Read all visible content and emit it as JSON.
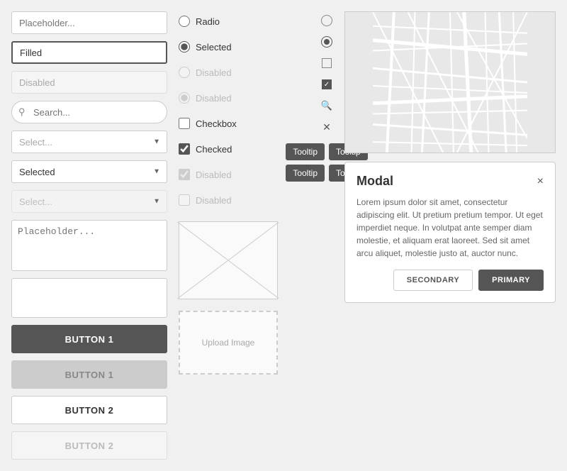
{
  "left": {
    "placeholder_label": "Placeholder...",
    "filled_label": "Filled",
    "disabled_label": "Disabled",
    "search_placeholder": "Search...",
    "select_placeholder": "Select...",
    "selected_value": "Selected",
    "select_disabled": "Select...",
    "textarea_placeholder": "Placeholder...",
    "btn1_primary": "BUTTON 1",
    "btn1_disabled": "BUTTON 1",
    "btn2_outline": "BUTTON 2",
    "btn2_disabled": "BUTTON 2"
  },
  "middle": {
    "radio_label": "Radio",
    "selected_label": "Selected",
    "disabled_radio1": "Disabled",
    "disabled_radio2": "Disabled",
    "checkbox_label": "Checkbox",
    "checked_label": "Checked",
    "disabled_check1": "Disabled",
    "disabled_check2": "Disabled",
    "tooltip1": "Tooltip",
    "tooltip2": "Tooltip",
    "tooltip3": "Tooltip",
    "tooltip4": "Tooltip",
    "upload_label": "Upload Image"
  },
  "modal": {
    "title": "Modal",
    "body": "Lorem ipsum dolor sit amet, consectetur adipiscing elit. Ut pretium pretium tempor. Ut eget imperdiet neque. In volutpat ante semper diam molestie, et aliquam erat laoreet. Sed sit amet arcu aliquet, molestie justo at, auctor nunc.",
    "secondary_btn": "SECONDARY",
    "primary_btn": "PRIMARY",
    "close_icon": "×"
  },
  "icons": {
    "search": "🔍",
    "x_mark": "✕"
  }
}
